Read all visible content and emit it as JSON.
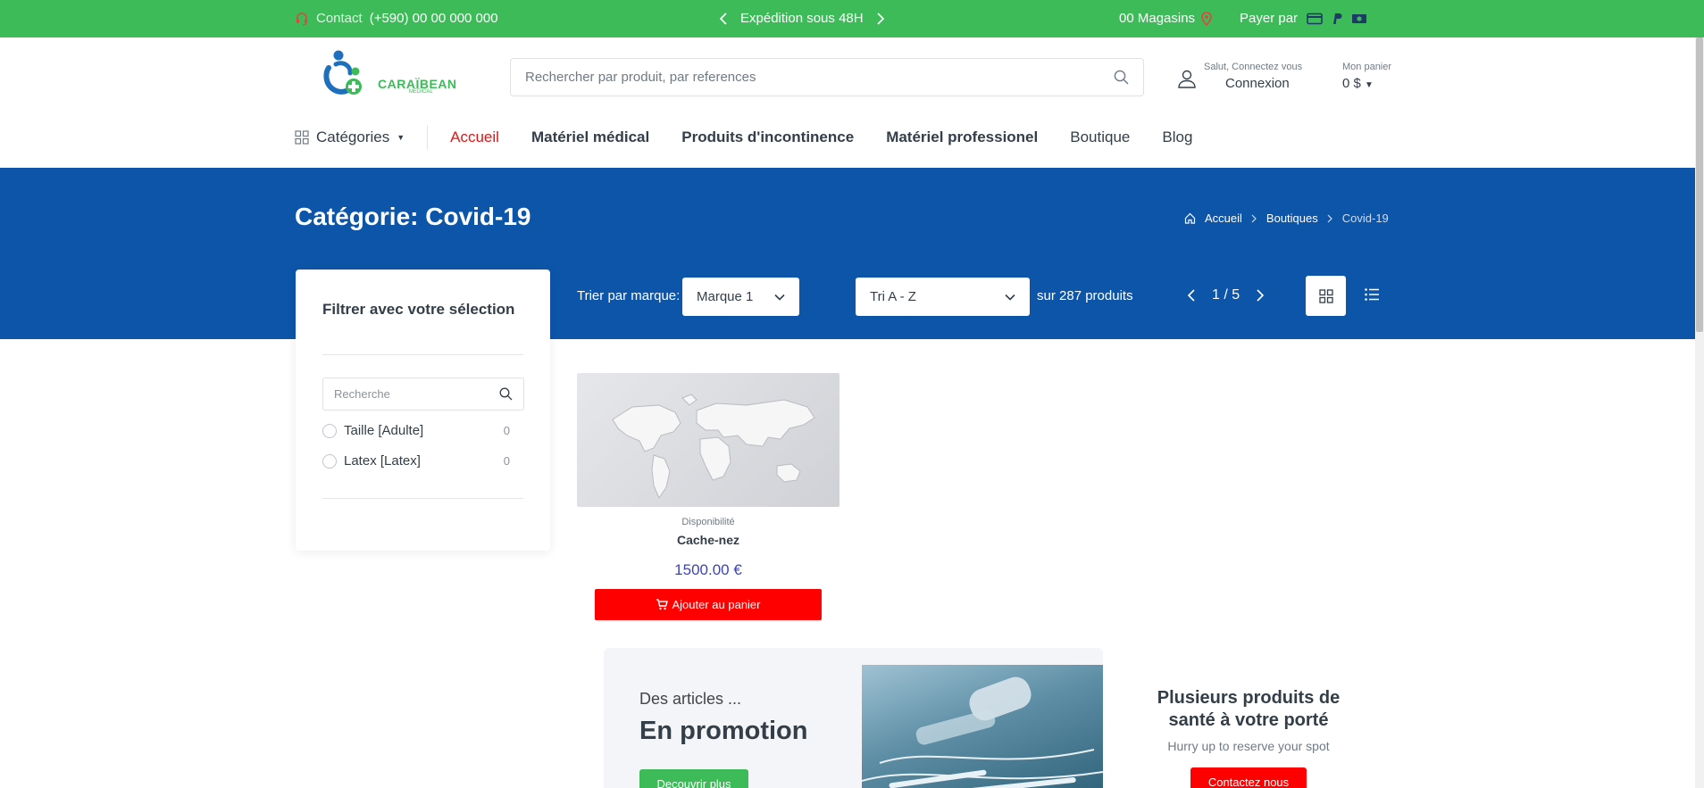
{
  "topbar": {
    "contact_label": "Contact",
    "phone": "(+590) 00 00 000 000",
    "promo": "Expédition sous 48H",
    "stores": "00 Magasins",
    "pay_label": "Payer par",
    "bg_color": "#3cbb58"
  },
  "header": {
    "logo_text": "CARAÏBEAN",
    "logo_sub": "MEDICAL",
    "search_placeholder": "Rechercher par produit, par references",
    "account_hello": "Salut, Connectez vous",
    "account_login": "Connexion",
    "cart_label": "Mon panier",
    "cart_amount": "0 $"
  },
  "nav": {
    "categories": "Catégories",
    "items": [
      "Accueil",
      "Matériel médical",
      "Produits d'incontinence",
      "Matériel professionel",
      "Boutique",
      "Blog"
    ],
    "active_color": "#e01616"
  },
  "hero": {
    "title": "Catégorie: Covid-19",
    "bg_color": "#0d55a8",
    "breadcrumb": [
      "Accueil",
      "Boutiques",
      "Covid-19"
    ]
  },
  "toolbar": {
    "brand_label": "Trier par marque:",
    "brand_value": "Marque 1",
    "sort_value": "Tri A - Z",
    "count": "sur 287 produits",
    "page": "1 / 5"
  },
  "filter": {
    "title": "Filtrer avec votre sélection",
    "search_placeholder": "Recherche",
    "options": [
      {
        "label": "Taille [Adulte]",
        "count": "0"
      },
      {
        "label": "Latex [Latex]",
        "count": "0"
      }
    ]
  },
  "product": {
    "availability": "Disponibilité",
    "name": "Cache-nez",
    "price": "1500.00 €",
    "add_label": "Ajouter au panier"
  },
  "promo": {
    "pre": "Des articles ...",
    "title": "En promotion",
    "button": "Decouvrir plus"
  },
  "side_promo": {
    "title": "Plusieurs produits de santé à votre porté",
    "subtitle": "Hurry up to reserve your spot",
    "button": "Contactez nous"
  }
}
